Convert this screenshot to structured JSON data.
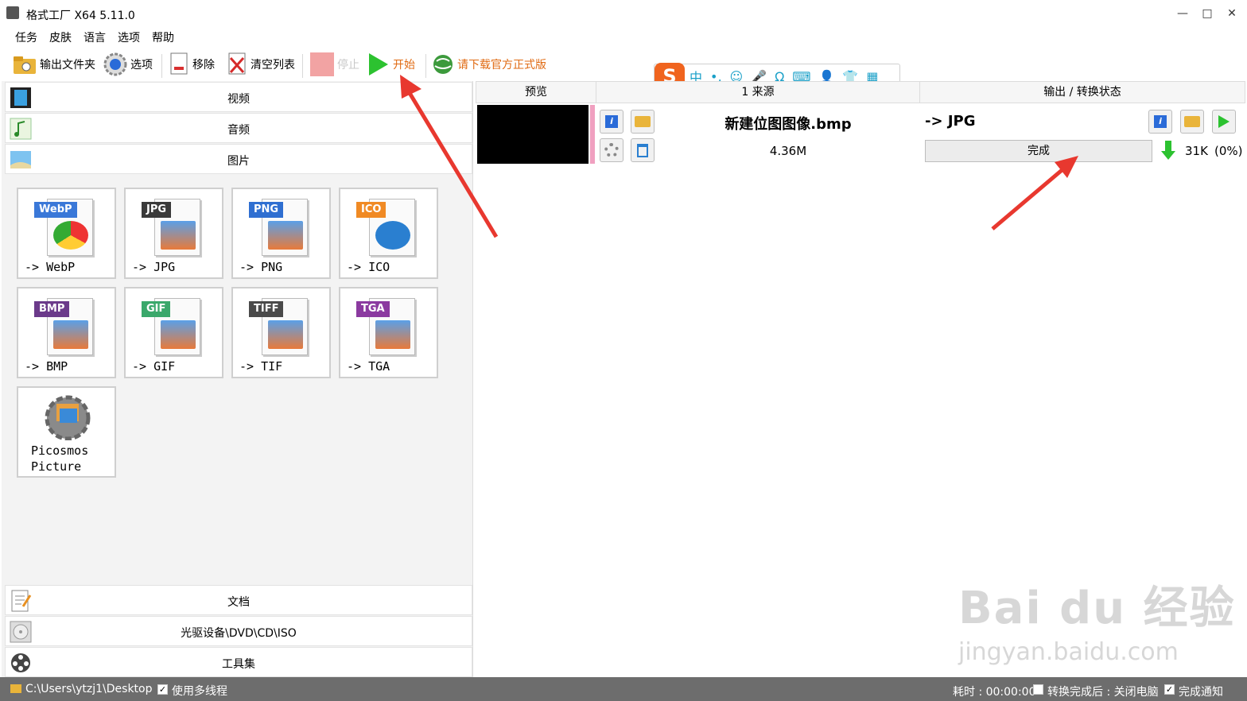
{
  "app": {
    "title": "格式工厂 X64 5.11.0"
  },
  "window_controls": {
    "minimize": "—",
    "maximize": "□",
    "close": "✕"
  },
  "menu": [
    "任务",
    "皮肤",
    "语言",
    "选项",
    "帮助"
  ],
  "toolbar": {
    "output_folder": "输出文件夹",
    "options": "选项",
    "remove": "移除",
    "clear_list": "清空列表",
    "stop": "停止",
    "start": "开始",
    "download": "请下载官方正式版"
  },
  "categories": {
    "video": "视频",
    "audio": "音频",
    "picture": "图片",
    "document": "文档",
    "disc": "光驱设备\\DVD\\CD\\ISO",
    "tools": "工具集"
  },
  "formats": [
    {
      "badge": "WebP",
      "label": "-> WebP",
      "color": "#3a78d8"
    },
    {
      "badge": "JPG",
      "label": "-> JPG",
      "color": "#3a3a3a"
    },
    {
      "badge": "PNG",
      "label": "-> PNG",
      "color": "#2f6fd1"
    },
    {
      "badge": "ICO",
      "label": "-> ICO",
      "color": "#f08a24"
    },
    {
      "badge": "BMP",
      "label": "-> BMP",
      "color": "#6b3a8a"
    },
    {
      "badge": "GIF",
      "label": "-> GIF",
      "color": "#3aa86b"
    },
    {
      "badge": "TIFF",
      "label": "-> TIF",
      "color": "#4a4a4a"
    },
    {
      "badge": "TGA",
      "label": "-> TGA",
      "color": "#8b3aa0"
    }
  ],
  "picosmos": {
    "line1": "Picosmos",
    "line2": "Picture"
  },
  "list_headers": {
    "preview": "预览",
    "source": "1 来源",
    "output": "输出 / 转换状态"
  },
  "task": {
    "filename": "新建位图图像.bmp",
    "size": "4.36M",
    "target": "-> JPG",
    "status": "完成",
    "output_size": "31K",
    "ratio": "(0%)"
  },
  "ime": {
    "logo": "S",
    "items": [
      "中",
      "•,",
      "☺",
      "🎤",
      "Ω",
      "⌨",
      "👤",
      "👕",
      "▦"
    ]
  },
  "statusbar": {
    "path": "C:\\Users\\ytzj1\\Desktop",
    "multithread": "使用多线程",
    "elapsed": "耗时 : 00:00:00",
    "after_done": "转换完成后 : 关闭电脑",
    "notify": "完成通知"
  },
  "watermark": {
    "brand": "Bai du 经验",
    "url": "jingyan.baidu.com"
  },
  "colors": {
    "accent_green": "#2cc230",
    "download_orange": "#e06a12",
    "arrow_red": "#e8382f"
  }
}
